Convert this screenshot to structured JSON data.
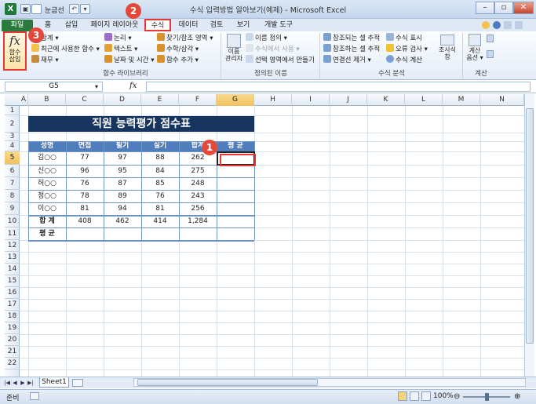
{
  "window": {
    "title": "수식 입력방법 알아보기(예제) - Microsoft Excel",
    "quick_access_label": "눈금선",
    "controls": {
      "minimize": "–",
      "restore": "▫",
      "close": "✕"
    }
  },
  "tabs": [
    "파일",
    "홈",
    "삽입",
    "페이지 레이아웃",
    "수식",
    "데이터",
    "검토",
    "보기",
    "개발 도구"
  ],
  "ribbon": {
    "insert_function": "함수\n삽입",
    "library": {
      "items": [
        "합계 ▾",
        "최근에 사용한 함수 ▾",
        "재무 ▾",
        "논리 ▾",
        "텍스트 ▾",
        "날짜 및 시간 ▾",
        "찾기/참조 영역 ▾",
        "수학/삼각 ▾",
        "함수 추가 ▾"
      ],
      "group_label": "함수 라이브러리"
    },
    "names": {
      "manager": "이름\n관리자",
      "items": [
        "이름 정의 ▾",
        "수식에서 사용 ▾",
        "선택 영역에서 만들기"
      ],
      "group_label": "정의된 이름"
    },
    "audit": {
      "items": [
        "참조되는 셀 추적",
        "참조하는 셀 추적",
        "연결선 제거 ▾",
        "수식 표시",
        "오류 검사 ▾",
        "수식 계산"
      ],
      "watch": "조사식\n창",
      "group_label": "수식 분석"
    },
    "calc": {
      "options": "계산\n옵션 ▾",
      "group_label": "계산"
    }
  },
  "formula_bar": {
    "name_box": "G5",
    "fx": "fx",
    "value": ""
  },
  "columns": [
    "A",
    "B",
    "C",
    "D",
    "E",
    "F",
    "G",
    "H",
    "I",
    "J",
    "K",
    "L",
    "M",
    "N"
  ],
  "selected": {
    "column": "G",
    "row": "5"
  },
  "rows": [
    "1",
    "2",
    "3",
    "4",
    "5",
    "6",
    "7",
    "8",
    "9",
    "10",
    "11",
    "12",
    "13",
    "14",
    "15",
    "16",
    "17",
    "18",
    "19",
    "20",
    "21",
    "22"
  ],
  "sheet": {
    "title": "직원 능력평가 점수표",
    "headers": [
      "성명",
      "면접",
      "필기",
      "실기",
      "합계",
      "평 균"
    ],
    "data": [
      [
        "김○○",
        "77",
        "97",
        "88",
        "262",
        ""
      ],
      [
        "신○○",
        "96",
        "95",
        "84",
        "275",
        ""
      ],
      [
        "허○○",
        "76",
        "87",
        "85",
        "248",
        ""
      ],
      [
        "정○○",
        "78",
        "89",
        "76",
        "243",
        ""
      ],
      [
        "이○○",
        "81",
        "94",
        "81",
        "256",
        ""
      ],
      [
        "합 계",
        "408",
        "462",
        "414",
        "1,284",
        ""
      ],
      [
        "평 균",
        "",
        "",
        "",
        "",
        ""
      ]
    ]
  },
  "badges": [
    "1",
    "2",
    "3"
  ],
  "sheet_tab": "Sheet1",
  "status": {
    "ready": "준비",
    "zoom": "100%"
  },
  "accent": {
    "file_tab": "#2a7a3b",
    "title_band": "#18355f",
    "header_fill": "#4f7dbd",
    "highlight": "#e53935"
  }
}
